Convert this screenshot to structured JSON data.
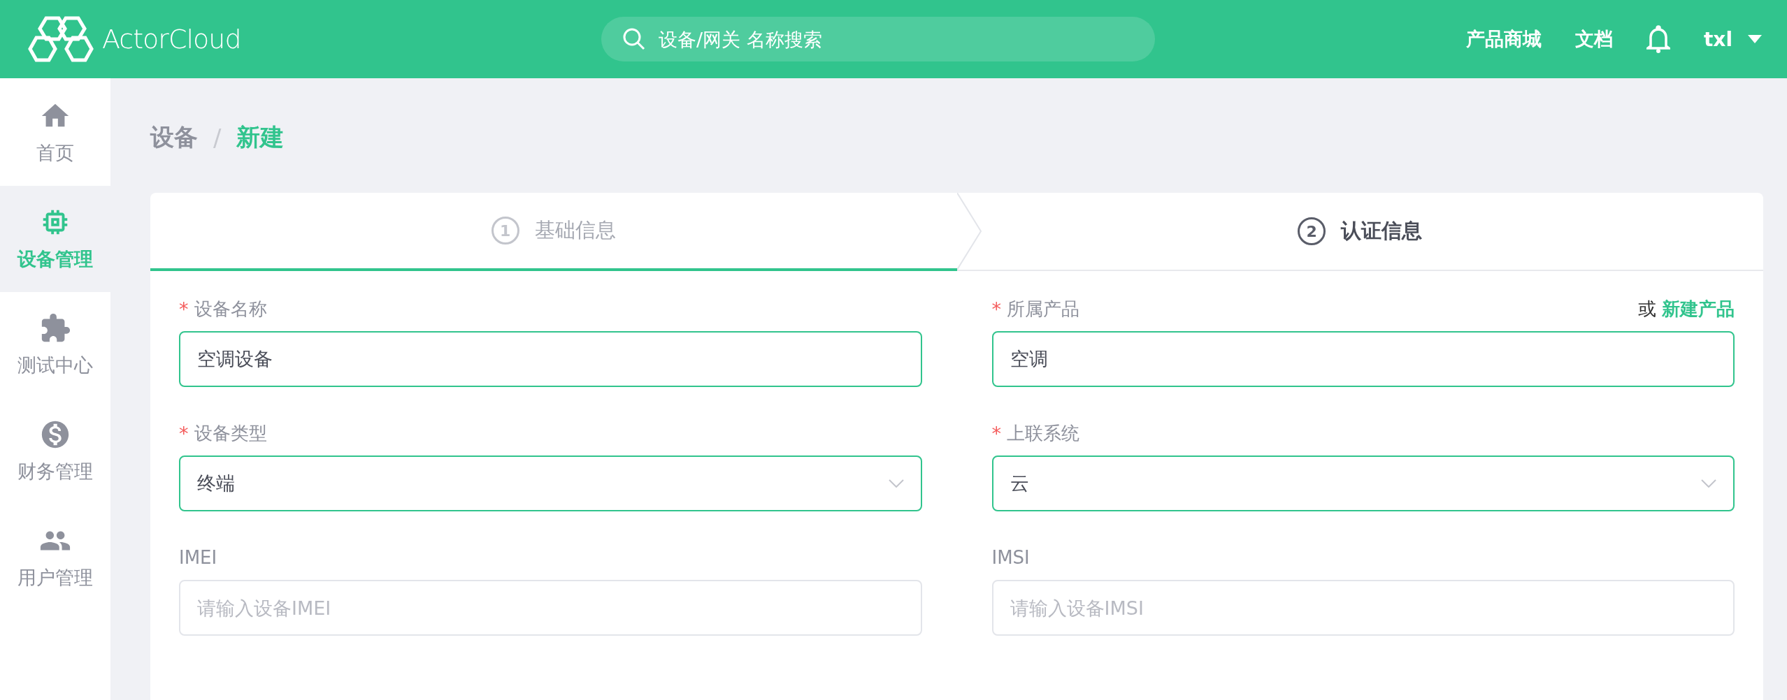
{
  "header": {
    "logo_text": "ActorCloud",
    "search": {
      "placeholder": "设备/网关 名称搜索"
    },
    "nav": [
      "产品商城",
      "文档"
    ],
    "user": "txl"
  },
  "sidebar": {
    "items": [
      {
        "label": "首页",
        "selected": false
      },
      {
        "label": "设备管理",
        "selected": true
      },
      {
        "label": "测试中心",
        "selected": false
      },
      {
        "label": "财务管理",
        "selected": false
      },
      {
        "label": "用户管理",
        "selected": false
      }
    ]
  },
  "breadcrumb": {
    "items": [
      "设备",
      "新建"
    ],
    "separator": "/"
  },
  "steps": [
    {
      "number": "1",
      "label": "基础信息",
      "selected": true,
      "current": false
    },
    {
      "number": "2",
      "label": "认证信息",
      "selected": false,
      "current": true
    }
  ],
  "form": {
    "fields": [
      {
        "label": "设备名称",
        "required_mark": "*",
        "kind": "text",
        "value": "空调设备",
        "validated": true
      },
      {
        "label": "所属产品",
        "required_mark": "*",
        "kind": "text",
        "value": "空调",
        "validated": true,
        "extra": {
          "prefix": "或",
          "link": "新建产品"
        }
      },
      {
        "label": "设备类型",
        "required_mark": "*",
        "kind": "select",
        "value": "终端",
        "validated": true
      },
      {
        "label": "上联系统",
        "required_mark": "*",
        "kind": "select",
        "value": "云",
        "validated": true
      },
      {
        "label": "IMEI",
        "kind": "text",
        "placeholder": "请输入设备IMEI",
        "validated": false
      },
      {
        "label": "IMSI",
        "kind": "text",
        "placeholder": "请输入设备IMSI",
        "validated": false
      }
    ]
  }
}
